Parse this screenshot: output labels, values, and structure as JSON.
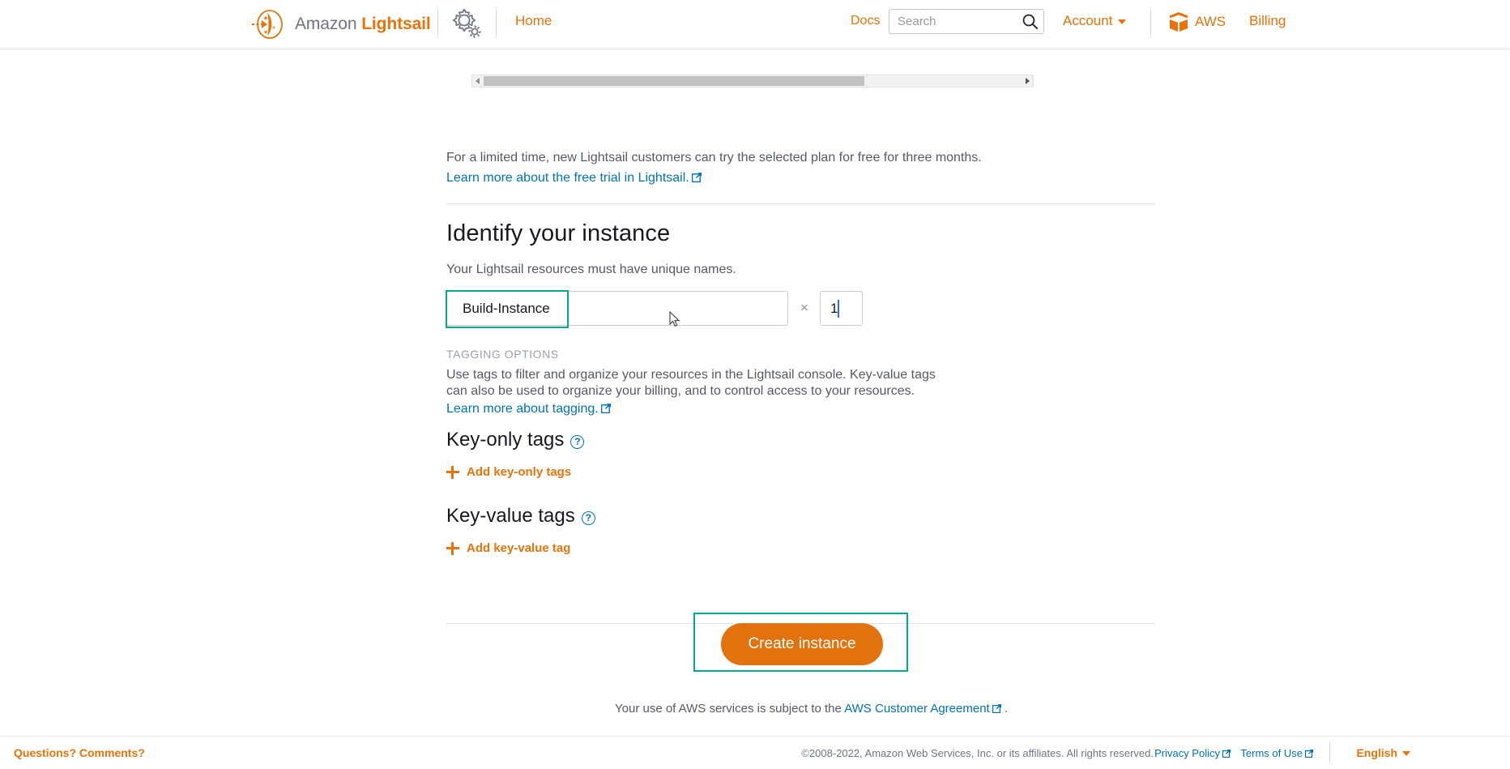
{
  "header": {
    "logo_text_plain": "Amazon ",
    "logo_text_bold": "Lightsail",
    "logo_icon": "lightsail-logo-icon",
    "gear_icon": "gear-settings-icon",
    "home": "Home",
    "docs": "Docs",
    "search_placeholder": "Search",
    "search_value": "",
    "search_icon": "search-icon",
    "account": "Account",
    "account_caret_icon": "chevron-down-icon",
    "aws": "AWS",
    "aws_icon": "aws-cube-icon",
    "billing": "Billing"
  },
  "scrollbar": {
    "left_arrow_icon": "scroll-left-arrow-icon",
    "right_arrow_icon": "scroll-right-arrow-icon"
  },
  "notice": {
    "text": "For a limited time, new Lightsail customers can try the selected plan for free for three months.",
    "link": "Learn more about the free trial in Lightsail.",
    "link_external_icon": "external-link-icon"
  },
  "identify": {
    "title": "Identify your instance",
    "subtitle": "Your Lightsail resources must have unique names.",
    "name_value": "Build-Instance",
    "name_placeholder": "",
    "multiplier": "×",
    "quantity_value": "1"
  },
  "tagging": {
    "section_label": "TAGGING OPTIONS",
    "description": "Use tags to filter and organize your resources in the Lightsail console. Key-value tags can also be used to organize your billing, and to control access to your resources.",
    "learn_link": "Learn more about tagging.",
    "learn_link_external_icon": "external-link-icon",
    "key_only_heading": "Key-only tags",
    "key_only_help_icon": "help-question-icon",
    "add_key_only": "Add key-only tags",
    "key_value_heading": "Key-value tags",
    "key_value_help_icon": "help-question-icon",
    "add_key_value": "Add key-value tag",
    "plus_icon": "plus-icon"
  },
  "actions": {
    "create_button": "Create instance"
  },
  "agreement": {
    "prefix": "Your use of AWS services is subject to the ",
    "link": "AWS Customer Agreement",
    "external_icon": "external-link-icon",
    "suffix": " ."
  },
  "footer": {
    "questions": "Questions? Comments?",
    "copyright": "©2008-2022, Amazon Web Services, Inc. or its affiliates. All rights reserved.",
    "privacy": "Privacy Policy",
    "terms": "Terms of Use",
    "language": "English",
    "language_caret_icon": "chevron-down-icon",
    "external_icon": "external-link-icon"
  },
  "colors": {
    "accent_orange": "#e8730a",
    "button_orange": "#e1720d",
    "link_blue": "#0073bb",
    "focus_teal": "#00a88e",
    "text_dark": "#16191f",
    "text_muted": "#545b64"
  }
}
